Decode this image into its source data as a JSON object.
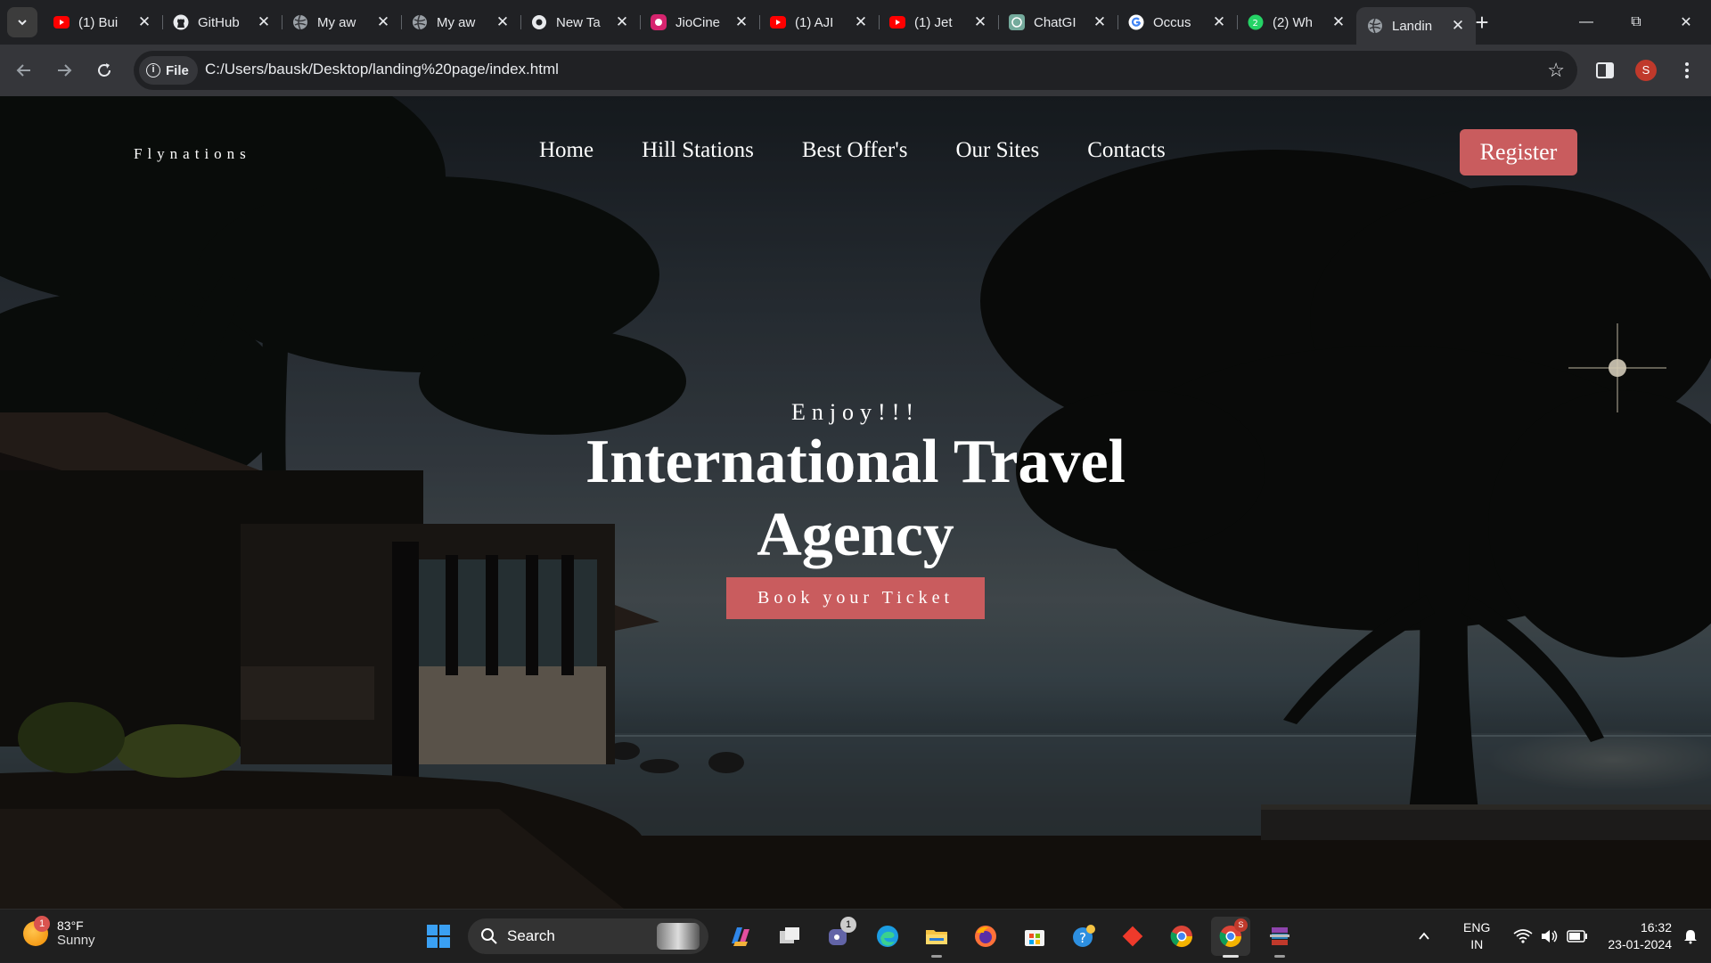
{
  "browser": {
    "tabs": [
      {
        "title": "(1) Bui",
        "icon": "youtube-icon",
        "active": false
      },
      {
        "title": "GitHub",
        "icon": "github-icon",
        "active": false
      },
      {
        "title": "My aw",
        "icon": "globe-icon",
        "active": false
      },
      {
        "title": "My aw",
        "icon": "globe-icon",
        "active": false
      },
      {
        "title": "New Ta",
        "icon": "chrome-icon",
        "active": false
      },
      {
        "title": "JioCine",
        "icon": "jiocinema-icon",
        "active": false
      },
      {
        "title": "(1) AJI",
        "icon": "youtube-icon",
        "active": false
      },
      {
        "title": "(1) Jet",
        "icon": "youtube-icon",
        "active": false
      },
      {
        "title": "ChatGI",
        "icon": "chatgpt-icon",
        "active": false
      },
      {
        "title": "Occus",
        "icon": "google-icon",
        "active": false
      },
      {
        "title": "(2) Wh",
        "icon": "whatsapp-icon",
        "active": false
      },
      {
        "title": "Landin",
        "icon": "globe-icon",
        "active": true
      }
    ],
    "address": {
      "chip_label": "File",
      "url": "C:/Users/bausk/Desktop/landing%20page/index.html"
    },
    "profile_initial": "S"
  },
  "site": {
    "brand": "Flynations",
    "nav": [
      "Home",
      "Hill Stations",
      "Best Offer's",
      "Our Sites",
      "Contacts"
    ],
    "register_label": "Register",
    "hero": {
      "kicker": "Enjoy!!!",
      "headline": "International Travel Agency",
      "cta_label": "Book your Ticket"
    },
    "colors": {
      "accent": "#c95c5e"
    }
  },
  "taskbar": {
    "weather": {
      "temp": "83°F",
      "condition": "Sunny",
      "badge": "1"
    },
    "search_placeholder": "Search",
    "teams_badge": "1",
    "chrome_badge": "S",
    "lang": {
      "line1": "ENG",
      "line2": "IN"
    },
    "clock": {
      "time": "16:32",
      "date": "23-01-2024"
    }
  }
}
